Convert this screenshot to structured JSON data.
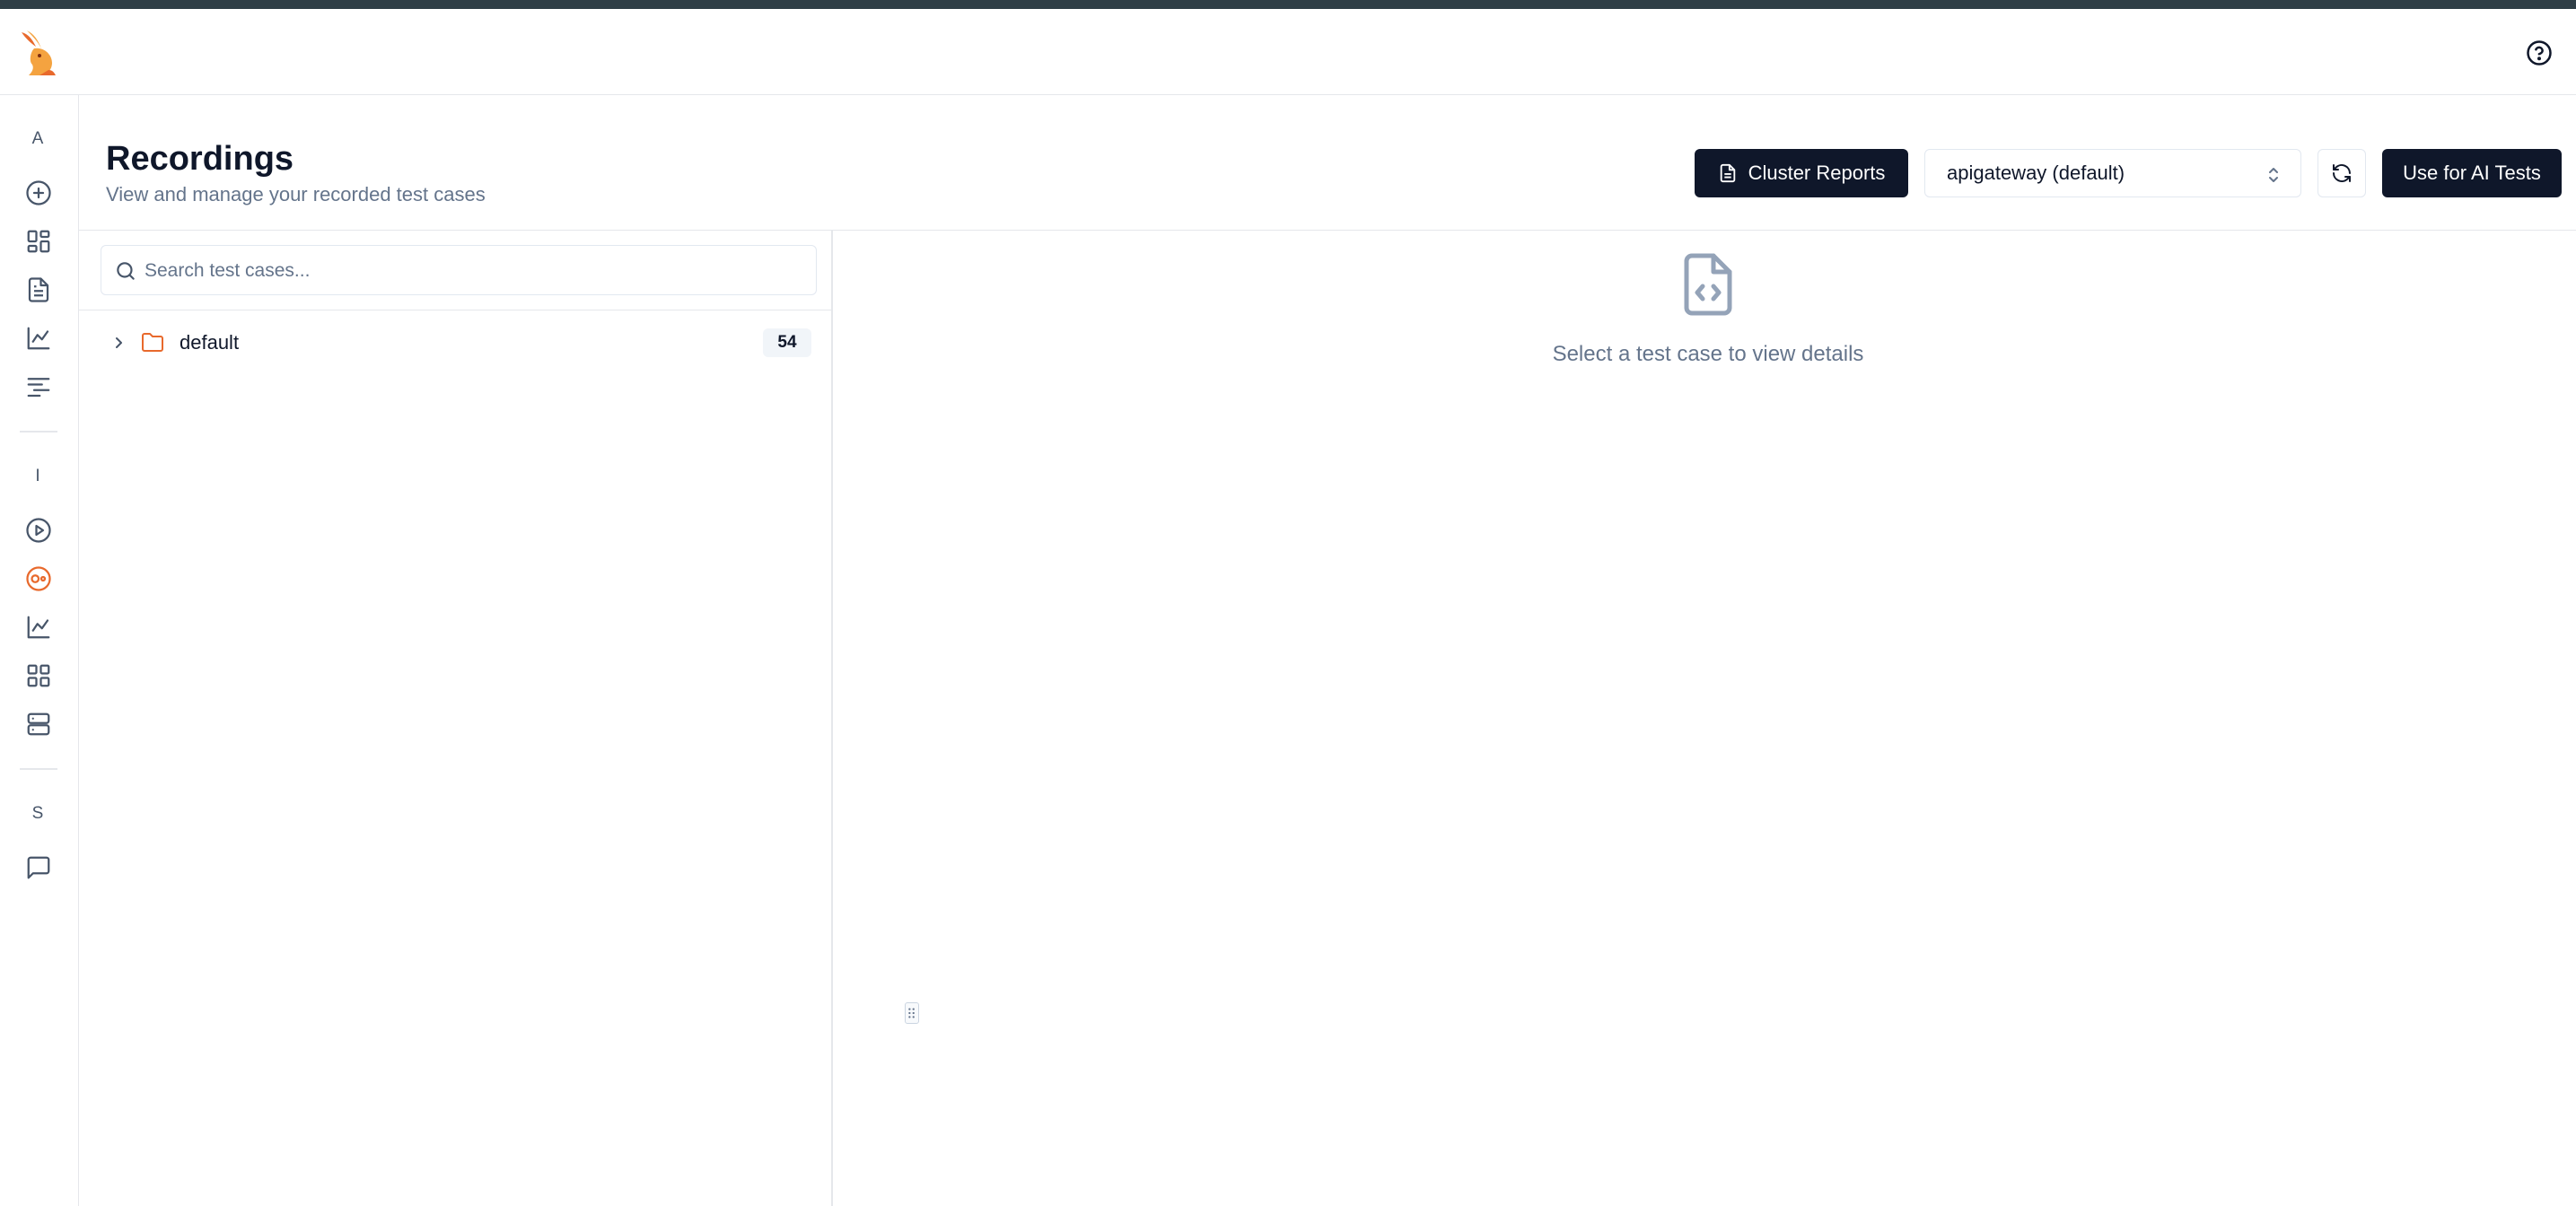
{
  "app": {
    "logo_icon": "rabbit-logo-icon",
    "help_icon": "help-circle-icon"
  },
  "sidebar": {
    "sections": [
      {
        "letter": "A",
        "items": [
          "plus-circle-icon",
          "dashboard-grid-icon",
          "document-icon",
          "line-chart-icon",
          "text-align-icon"
        ]
      },
      {
        "letter": "I",
        "items": [
          "play-circle-icon",
          "recording-icon",
          "line-chart-icon",
          "dashboard-grid-icon",
          "server-icon"
        ]
      },
      {
        "letter": "S",
        "items": [
          "message-square-icon"
        ]
      }
    ],
    "active_item": "recording-icon",
    "active_color": "#e8692c"
  },
  "header": {
    "title": "Recordings",
    "subtitle": "View and manage your recorded test cases",
    "cluster_reports_label": "Cluster Reports",
    "service_select_value": "apigateway (default)",
    "ai_tests_label": "Use for AI Tests"
  },
  "left_pane": {
    "search_placeholder": "Search test cases...",
    "folders": [
      {
        "name": "default",
        "count": "54"
      }
    ]
  },
  "right_pane": {
    "empty_message": "Select a test case to view details"
  },
  "colors": {
    "primary_dark": "#0f172a",
    "accent_orange": "#e8692c",
    "muted_text": "#64748b",
    "border": "#e5e7eb"
  }
}
